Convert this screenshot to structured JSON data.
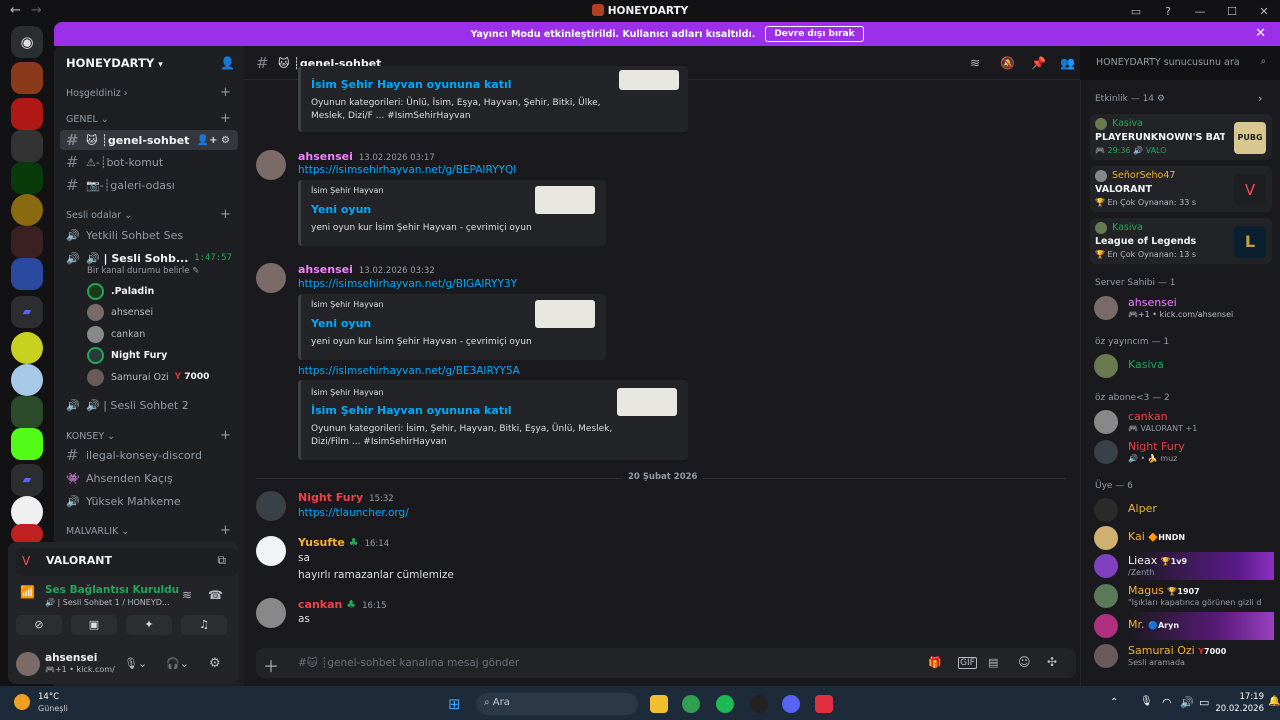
{
  "window": {
    "title": "HONEYDARTY"
  },
  "banner": {
    "text": "Yayıncı Modu etkinleştirildi. Kullanıcı adları kısaltıldı.",
    "button": "Devre dışı bırak"
  },
  "server": {
    "name": "HONEYDARTY"
  },
  "sidebar": {
    "welcome": "Hoşgeldiniz",
    "cat_general": "GENEL",
    "channels": [
      "🐱 ┊genel-sohbet",
      "⚠-┊bot-komut",
      "📷-┊galeri-odası"
    ],
    "cat_voice": "Sesli odalar",
    "voice_channels": [
      "Yetkili Sohbet Ses",
      "🔊 | Sesli Sohb...",
      "🔊 | Sesli Sohbet 2"
    ],
    "voice_timer": "1:47:57",
    "voice_status": "Bir kanal durumu belirle",
    "voice_users": [
      ".Paladin",
      "ahsensei",
      "cankan",
      "Night Fury",
      "Samurai Ozi"
    ],
    "samurai_badge": "7000",
    "cat_konsey": "KONSEY",
    "konsey_channels": [
      "ilegal-konsey-discord",
      "Ahsenden Kaçış",
      "Yüksek Mahkeme"
    ],
    "cat_malvarlik": "MALVARLIK"
  },
  "activity_panel": {
    "game": "VALORANT"
  },
  "voice_panel": {
    "status": "Ses Bağlantısı Kuruldu",
    "channel": "🔊 | Sesli Sohbet 1 / HONEYD..."
  },
  "user_panel": {
    "name": "ahsensei",
    "sub": "🎮+1 • kick.com/:"
  },
  "channel_header": {
    "name": "🐱 ┊genel-sohbet",
    "search_placeholder": "HONEYDARTY sunucusunu ara"
  },
  "messages": {
    "embed0": {
      "title": "İsim Şehir Hayvan oyununa katıl",
      "desc": "Oyunun kategorileri: Ünlü, İsim, Eşya, Hayvan, Şehir, Bitki, Ülke, Meslek, Dizi/F ... #IsimSehirHayvan"
    },
    "m1": {
      "author": "ahsensei",
      "time": "13.02.2026 03:17",
      "link": "https://isimsehirhayvan.net/g/BEPAIRYYQI",
      "provider": "İsim Şehir Hayvan",
      "title": "Yeni oyun",
      "desc": "yeni oyun kur İsim Şehir Hayvan - çevrimiçi oyun"
    },
    "m2": {
      "author": "ahsensei",
      "time": "13.02.2026 03:32",
      "link": "https://isimsehirhayvan.net/g/BIGAIRYY3Y",
      "provider": "İsim Şehir Hayvan",
      "title": "Yeni oyun",
      "desc": "yeni oyun kur İsim Şehir Hayvan - çevrimiçi oyun"
    },
    "m3": {
      "link": "https://isimsehirhayvan.net/g/BE3AIRYY5A",
      "provider": "İsim Şehir Hayvan",
      "title": "İsim Şehir Hayvan oyununa katıl",
      "desc": "Oyunun kategorileri: İsim, Şehir, Hayvan, Bitki, Eşya, Ünlü, Meslek, Dizi/Film ... #IsimSehirHayvan"
    },
    "divider": "20 Şubat 2026",
    "m4": {
      "author": "Night Fury",
      "time": "15:32",
      "link": "https://tlauncher.org/"
    },
    "m5": {
      "author": "Yusufte",
      "time": "16:14",
      "line1": "sa",
      "line2": "hayırlı ramazanlar cümlemize"
    },
    "m6": {
      "author": "cankan",
      "time": "16:15",
      "line1": "as"
    }
  },
  "composer": {
    "placeholder": "#🐱 ┊genel-sohbet kanalına mesaj gönder"
  },
  "members": {
    "activity_header": "Etkinlik — 14",
    "activities": [
      {
        "name": "Kasiva",
        "game": "PLAYERUNKNOWN'S BATT...",
        "meta": "🎮 29:36  🔊 VALO"
      },
      {
        "name": "SeñorSeho47",
        "game": "VALORANT",
        "meta": "🏆 En Çok Oynanan: 33 s"
      },
      {
        "name": "Kasiva",
        "game": "League of Legends",
        "meta": "🏆 En Çok Oynanan: 13 s"
      }
    ],
    "owner_header": "Server Sahibi — 1",
    "owner": {
      "name": "ahsensei",
      "sub": "🎮+1 • kick.com/ahsensei"
    },
    "streamer_header": "öz yayıncım — 1",
    "streamer": {
      "name": "Kasiva"
    },
    "sub_header": "öz abone<3 — 2",
    "subs": [
      {
        "name": "cankan",
        "sub": "🎮 VALORANT +1"
      },
      {
        "name": "Night Fury",
        "sub": "🔊 • 🍌 muz"
      }
    ],
    "member_header": "Üye — 6",
    "list": [
      {
        "name": "Alper",
        "sub": "",
        "badge": "",
        "color": "#f0b232"
      },
      {
        "name": "Kai",
        "sub": "",
        "badge": "HNDN",
        "color": "#f0b232"
      },
      {
        "name": "Lieax",
        "sub": "/Zenth",
        "badge": "1v9",
        "color": "#f2f3f5"
      },
      {
        "name": "Magus",
        "sub": "\"Işıkları kapatınca görünen gizli d",
        "badge": "1907",
        "color": "#f0b232"
      },
      {
        "name": "Mr.",
        "sub": "",
        "badge": "Aryn",
        "color": "#f0b232"
      },
      {
        "name": "Samurai Ozi",
        "sub": "Sesli aramada",
        "badge": "7000",
        "color": "#f0b232"
      }
    ]
  },
  "taskbar": {
    "weather_temp": "14°C",
    "weather_desc": "Güneşli",
    "search": "Ara",
    "time": "17:19",
    "date": "20.02.2026"
  }
}
